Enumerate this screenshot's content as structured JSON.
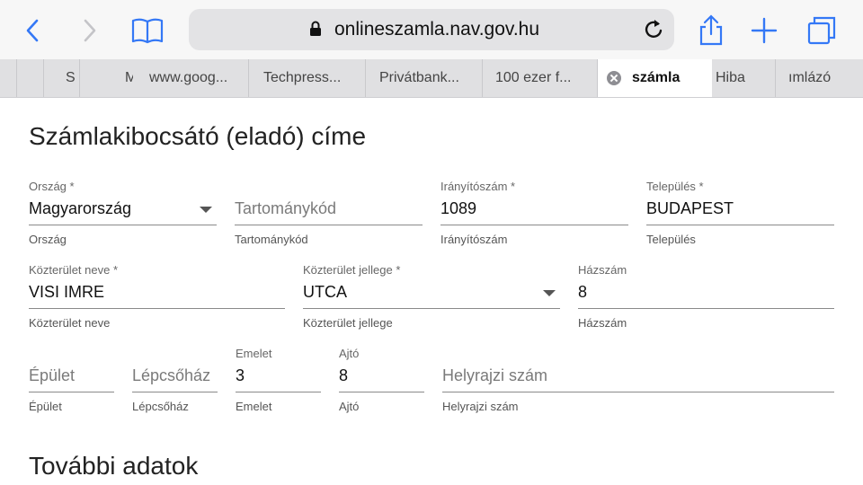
{
  "browser": {
    "url": "onlineszamla.nav.gov.hu",
    "tabs": [
      {
        "label": "S"
      },
      {
        "label": "M"
      },
      {
        "label": "www.goog..."
      },
      {
        "label": "Techpress..."
      },
      {
        "label": "Privátbank..."
      },
      {
        "label": "100 ezer f..."
      },
      {
        "label": "számla"
      },
      {
        "label": "Hiba"
      },
      {
        "label": "ımlázó"
      }
    ]
  },
  "form": {
    "section_title": "Számlakibocsátó (eladó) címe",
    "next_section_title": "További adatok",
    "orszag": {
      "label": "Ország *",
      "value": "Magyarország",
      "helper": "Ország"
    },
    "tartomany": {
      "placeholder": "Tartománykód",
      "helper": "Tartománykód"
    },
    "iranyitoszam": {
      "label": "Irányítószám *",
      "value": "1089",
      "helper": "Irányítószám"
    },
    "telepules": {
      "label": "Település *",
      "value": "BUDAPEST",
      "helper": "Település"
    },
    "kozterulet_neve": {
      "label": "Közterület neve *",
      "value": "VISI IMRE",
      "helper": "Közterület neve"
    },
    "kozterulet_jellege": {
      "label": "Közterület jellege *",
      "value": "UTCA",
      "helper": "Közterület jellege"
    },
    "hazszam": {
      "label": "Házszám",
      "value": "8",
      "helper": "Házszám"
    },
    "epulet": {
      "placeholder": "Épület",
      "helper": "Épület"
    },
    "lepcsohaz": {
      "placeholder": "Lépcsőház",
      "helper": "Lépcsőház"
    },
    "emelet": {
      "label": "Emelet",
      "value": "3",
      "helper": "Emelet"
    },
    "ajto": {
      "label": "Ajtó",
      "value": "8",
      "helper": "Ajtó"
    },
    "helyrajzi": {
      "placeholder": "Helyrajzi szám",
      "helper": "Helyrajzi szám"
    }
  }
}
